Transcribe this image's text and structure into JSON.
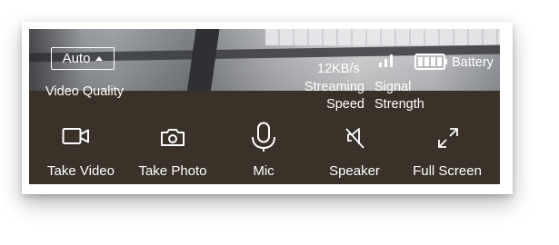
{
  "quality": {
    "selected": "Auto",
    "label": "Video Quality"
  },
  "stats": {
    "speed_value": "12KB/s",
    "speed_label_line1": "Streaming",
    "speed_label_line2": "Speed",
    "signal_label_line1": "Signal",
    "signal_label_line2": "Strength",
    "battery_label": "Battery"
  },
  "toolbar": {
    "take_video": "Take Video",
    "take_photo": "Take Photo",
    "mic": "Mic",
    "speaker": "Speaker",
    "full_screen": "Full Screen"
  },
  "icons": {
    "video": "video-camera-icon",
    "photo": "camera-icon",
    "mic": "microphone-icon",
    "speaker": "speaker-muted-icon",
    "fullscreen": "expand-icon",
    "signal": "signal-bars-icon",
    "battery": "battery-icon"
  }
}
